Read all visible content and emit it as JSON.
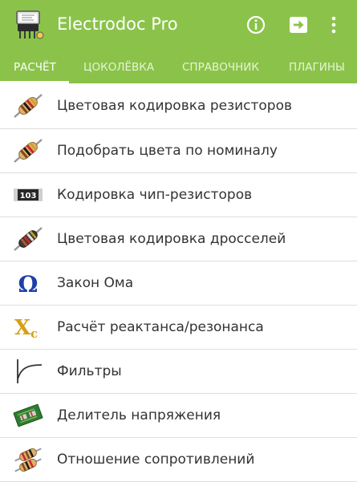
{
  "app": {
    "title": "Electrodoc Pro",
    "theme_color": "#8bc34a"
  },
  "actions": [
    {
      "name": "info-icon"
    },
    {
      "name": "exit-icon"
    },
    {
      "name": "more-vertical-icon"
    }
  ],
  "tabs": [
    {
      "label": "РАСЧЁТ",
      "active": true
    },
    {
      "label": "ЦОКОЛЁВКА",
      "active": false
    },
    {
      "label": "СПРАВОЧНИК",
      "active": false
    },
    {
      "label": "ПЛАГИНЫ",
      "active": false
    }
  ],
  "items": [
    {
      "label": "Цветовая кодировка резисторов",
      "icon": "resistor-icon"
    },
    {
      "label": "Подобрать цвета по номиналу",
      "icon": "resistor-icon"
    },
    {
      "label": "Кодировка чип-резисторов",
      "icon": "chip-resistor-icon",
      "icon_text": "103"
    },
    {
      "label": "Цветовая кодировка дросселей",
      "icon": "inductor-icon"
    },
    {
      "label": "Закон Ома",
      "icon": "ohm-icon",
      "icon_text": "Ω"
    },
    {
      "label": "Расчёт реактанса/резонанса",
      "icon": "reactance-icon",
      "icon_text": "X",
      "icon_subtext": "c"
    },
    {
      "label": "Фильтры",
      "icon": "filter-curve-icon"
    },
    {
      "label": "Делитель напряжения",
      "icon": "pcb-board-icon"
    },
    {
      "label": "Отношение сопротивлений",
      "icon": "resistor-pair-icon"
    }
  ]
}
